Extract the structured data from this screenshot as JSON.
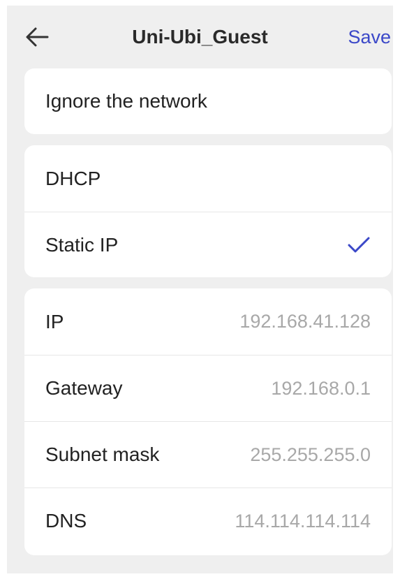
{
  "header": {
    "title": "Uni-Ubi_Guest",
    "save_label": "Save"
  },
  "network": {
    "ignore_label": "Ignore the network"
  },
  "ip_mode": {
    "options": [
      {
        "label": "DHCP",
        "selected": false
      },
      {
        "label": "Static IP",
        "selected": true
      }
    ]
  },
  "static_config": {
    "fields": [
      {
        "label": "IP",
        "value": "192.168.41.128"
      },
      {
        "label": "Gateway",
        "value": "192.168.0.1"
      },
      {
        "label": "Subnet mask",
        "value": "255.255.255.0"
      },
      {
        "label": "DNS",
        "value": "114.114.114.114"
      }
    ]
  },
  "colors": {
    "accent": "#3b48c8",
    "background": "#efefef",
    "card": "#ffffff",
    "value_text": "#a8a8a8"
  },
  "icons": {
    "back": "back-arrow-icon",
    "selected": "checkmark-icon"
  }
}
